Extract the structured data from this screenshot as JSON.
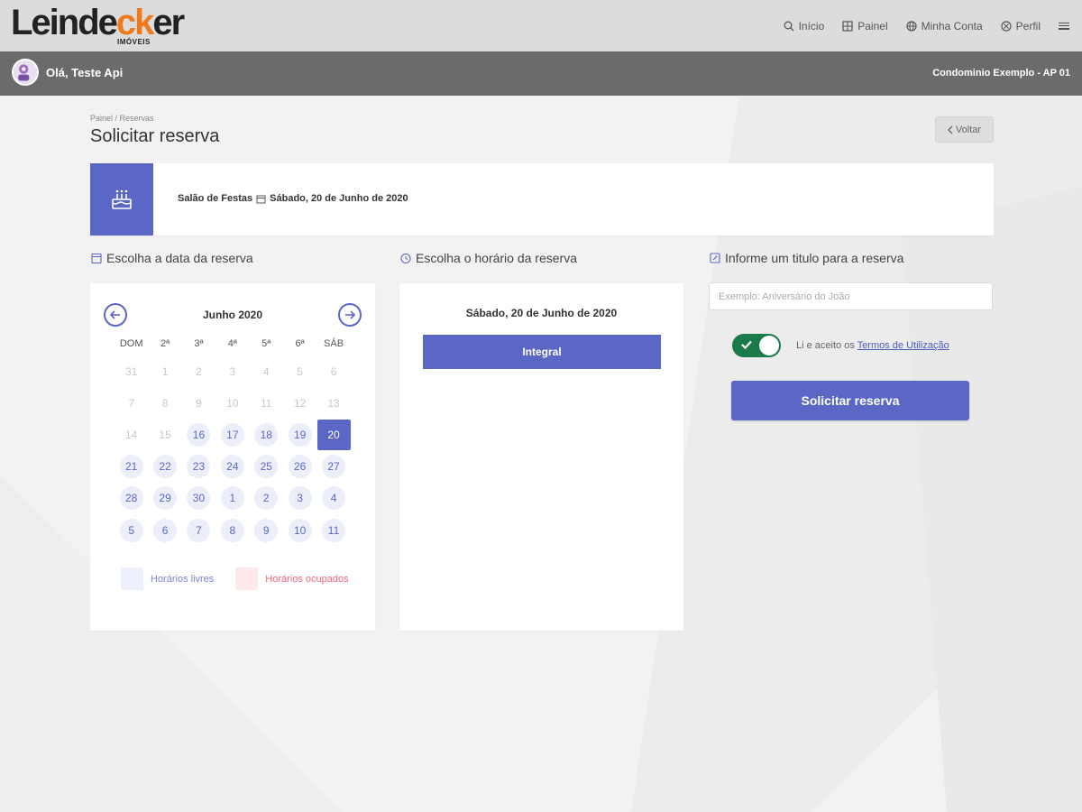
{
  "brand": {
    "name_left": "Leinde",
    "name_accent": "ck",
    "name_right": "er",
    "subtitle": "IMÓVEIS",
    "accent_color": "#ee7a1c"
  },
  "nav": {
    "items": [
      {
        "label": "Início",
        "icon": "search-icon"
      },
      {
        "label": "Painel",
        "icon": "grid-icon"
      },
      {
        "label": "Minha Conta",
        "icon": "globe-icon"
      },
      {
        "label": "Perfil",
        "icon": "user-circle-icon"
      }
    ],
    "menu_icon": "hamburger-menu-icon"
  },
  "user": {
    "greeting": "Olá, Teste Api",
    "condo": "Condominio Exemplo - AP 01"
  },
  "page": {
    "breadcrumb": "Painel / Reservas",
    "title": "Solicitar reserva",
    "back_label": "Voltar"
  },
  "resource": {
    "name": "Salão de Festas",
    "date": "Sábado, 20 de Junho de 2020",
    "icon": "cake-icon",
    "color": "#5b67c4"
  },
  "sections": {
    "date_title": "Escolha a data da reserva",
    "time_title": "Escolha o horário da reserva",
    "name_title": "Informe um titulo para a reserva"
  },
  "calendar": {
    "month": "Junho 2020",
    "weekdays": [
      "DOM",
      "2ª",
      "3ª",
      "4ª",
      "5ª",
      "6ª",
      "SÁB"
    ],
    "days": [
      {
        "d": "31",
        "s": "past"
      },
      {
        "d": "1",
        "s": "past"
      },
      {
        "d": "2",
        "s": "past"
      },
      {
        "d": "3",
        "s": "past"
      },
      {
        "d": "4",
        "s": "past"
      },
      {
        "d": "5",
        "s": "past"
      },
      {
        "d": "6",
        "s": "past"
      },
      {
        "d": "7",
        "s": "past"
      },
      {
        "d": "8",
        "s": "past"
      },
      {
        "d": "9",
        "s": "past"
      },
      {
        "d": "10",
        "s": "past"
      },
      {
        "d": "11",
        "s": "past"
      },
      {
        "d": "12",
        "s": "past"
      },
      {
        "d": "13",
        "s": "past"
      },
      {
        "d": "14",
        "s": "past"
      },
      {
        "d": "15",
        "s": "past"
      },
      {
        "d": "16",
        "s": "free"
      },
      {
        "d": "17",
        "s": "free"
      },
      {
        "d": "18",
        "s": "free"
      },
      {
        "d": "19",
        "s": "free"
      },
      {
        "d": "20",
        "s": "selected"
      },
      {
        "d": "21",
        "s": "free"
      },
      {
        "d": "22",
        "s": "free"
      },
      {
        "d": "23",
        "s": "free"
      },
      {
        "d": "24",
        "s": "free"
      },
      {
        "d": "25",
        "s": "free"
      },
      {
        "d": "26",
        "s": "free"
      },
      {
        "d": "27",
        "s": "free"
      },
      {
        "d": "28",
        "s": "free"
      },
      {
        "d": "29",
        "s": "free"
      },
      {
        "d": "30",
        "s": "free"
      },
      {
        "d": "1",
        "s": "free"
      },
      {
        "d": "2",
        "s": "free"
      },
      {
        "d": "3",
        "s": "free"
      },
      {
        "d": "4",
        "s": "free"
      },
      {
        "d": "5",
        "s": "free"
      },
      {
        "d": "6",
        "s": "free"
      },
      {
        "d": "7",
        "s": "free"
      },
      {
        "d": "8",
        "s": "free"
      },
      {
        "d": "9",
        "s": "free"
      },
      {
        "d": "10",
        "s": "free"
      },
      {
        "d": "11",
        "s": "free"
      }
    ],
    "legend_free": "Horários livres",
    "legend_busy": "Horários ocupados",
    "free_color": "#eef0fb",
    "busy_color": "#fde9ea"
  },
  "hours": {
    "date": "Sábado, 20 de Junho de 2020",
    "slot": "Integral"
  },
  "form": {
    "title_placeholder": "Exemplo: Aniversário do João",
    "title_value": "",
    "terms_prefix": "Li e aceito os ",
    "terms_link": "Termos de Utilização",
    "terms_accepted": true,
    "submit_label": "Solicitar reserva",
    "toggle_color": "#1a7a4a"
  }
}
